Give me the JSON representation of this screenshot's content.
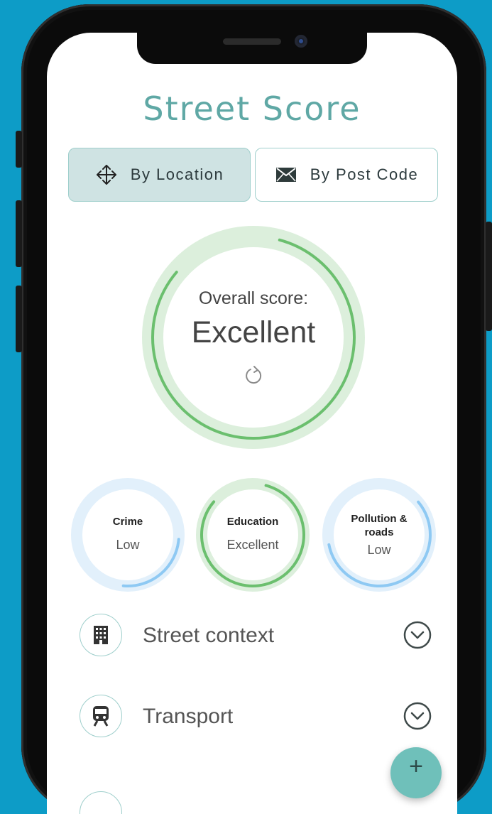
{
  "app": {
    "title": "Street Score"
  },
  "mode_toggle": {
    "location_label": "By Location",
    "postcode_label": "By Post Code",
    "active": "location"
  },
  "overall": {
    "label": "Overall score:",
    "value": "Excellent",
    "ring_progress": 0.82,
    "color": "#6bbf6e",
    "track_color": "#dcefdc"
  },
  "categories": [
    {
      "name": "Crime",
      "value": "Low",
      "ring_progress": 0.25,
      "color": "#8ec9f3",
      "track_color": "#e2f0fb"
    },
    {
      "name": "Education",
      "value": "Excellent",
      "ring_progress": 0.82,
      "color": "#6bbf6e",
      "track_color": "#dcefdc"
    },
    {
      "name": "Pollution & roads",
      "value": "Low",
      "ring_progress": 0.58,
      "color": "#8ec9f3",
      "track_color": "#e2f0fb"
    }
  ],
  "sections": [
    {
      "label": "Street context",
      "icon": "building-icon"
    },
    {
      "label": "Transport",
      "icon": "train-icon"
    }
  ],
  "fab": {
    "label": "+"
  },
  "theme": {
    "accent": "#5fa8a5",
    "background": "#0d9cc7"
  }
}
